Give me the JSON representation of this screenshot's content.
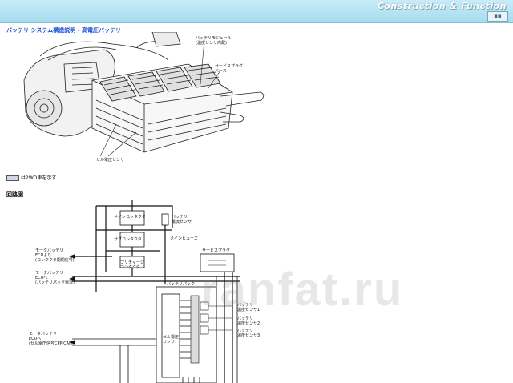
{
  "header": {
    "title": "Construction & Function",
    "button": "▪▪"
  },
  "page": {
    "heading": "バッテリ システム構造説明 - 高電圧バッテリ",
    "section": "回路図",
    "note": "は2WD車を示す",
    "watermark": "ranfat.ru"
  },
  "labels": {
    "module": "バッテリモジュール\n(温度センサ内蔵)",
    "plug": "サービスプラグ\nベース",
    "cell_sensor": "セル電圧センサ",
    "main_contactor": "メインコンタクタ",
    "current_sensor": "バッテリ\n電流センサ",
    "main_fuse": "メインヒューズ",
    "sub_contactor": "サブコンタクタ",
    "precharge": "プリチャージ\nコンタクタ",
    "service_plug": "サービスプラグ",
    "ecu1": "モータバッテリ\nECUより\n(コンタクタ開閉信号)",
    "ecu2": "モータバッテリ\nECUへ\n(バッテリパック電流)",
    "pack": "バッテリパック",
    "cell_module": "セル電圧\nセンサ",
    "temp1": "バッテリ\n温度センサ1",
    "temp2": "バッテリ\n温度センサ2",
    "temp3": "バッテリ\n温度センサ3",
    "ecu3": "モータバッテリ\nECUへ\n(セル電圧信号CPP-CAN)"
  }
}
